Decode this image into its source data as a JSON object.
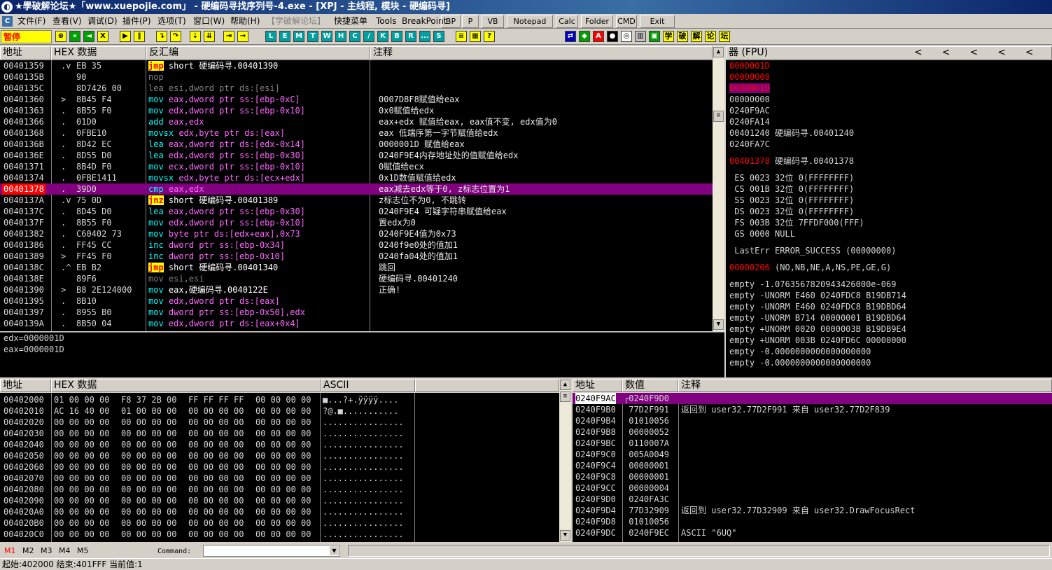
{
  "title": "★學破解论坛★「www.xuepojie.com」 - 硬编码寻找序列号-4.exe - [XPJ - 主线程, 模块 - 硬编码寻]",
  "menu": [
    "文件(F)",
    "查看(V)",
    "调试(D)",
    "插件(P)",
    "选项(T)",
    "窗口(W)",
    "帮助(H)",
    "【学破解论坛】",
    "快捷菜单",
    "Tools",
    "BreakPoint"
  ],
  "quick_buttons": [
    "BP",
    "P",
    "VB",
    "Notepad",
    "Calc",
    "Folder",
    "CMD",
    "Exit"
  ],
  "state": "暂停",
  "toolbar_letters": [
    "L",
    "E",
    "M",
    "T",
    "W",
    "H",
    "C",
    "/",
    "K",
    "B",
    "R",
    "...",
    "S"
  ],
  "toolbar_right": [
    "学",
    "破",
    "解",
    "论",
    "坛"
  ],
  "cpu_headers": {
    "addr": "地址",
    "hex": "HEX 数据",
    "asm": "反汇编",
    "comment": "注释"
  },
  "disasm": [
    {
      "a": "00401359",
      "m": ".v",
      "h": "EB 35",
      "op": "jmp",
      "args": "short 硬编码寻.00401390",
      "c": ""
    },
    {
      "a": "0040135B",
      "m": "",
      "h": "90",
      "op": "nop",
      "args": "",
      "c": ""
    },
    {
      "a": "0040135C",
      "m": "",
      "h": "8D7426 00",
      "op": "lea",
      "args": "esi,dword ptr ds:[esi]",
      "c": ""
    },
    {
      "a": "00401360",
      "m": ">",
      "h": "8B45 F4",
      "op": "mov",
      "args": "eax,dword ptr ss:[ebp-0xC]",
      "c": "0007D8F8赋值给eax"
    },
    {
      "a": "00401363",
      "m": ".",
      "h": "8B55 F0",
      "op": "mov",
      "args": "edx,dword ptr ss:[ebp-0x10]",
      "c": "0x0赋值给edx"
    },
    {
      "a": "00401366",
      "m": ".",
      "h": "01D0",
      "op": "add",
      "args": "eax,edx",
      "c": "eax+edx 赋值给eax, eax值不变, edx值为0"
    },
    {
      "a": "00401368",
      "m": ".",
      "h": "0FBE10",
      "op": "movsx",
      "args": "edx,byte ptr ds:[eax]",
      "c": "eax 低端序第一字节赋值给edx"
    },
    {
      "a": "0040136B",
      "m": ".",
      "h": "8D42 EC",
      "op": "lea",
      "args": "eax,dword ptr ds:[edx-0x14]",
      "c": "0000001D 赋值给eax"
    },
    {
      "a": "0040136E",
      "m": ".",
      "h": "8D55 D0",
      "op": "lea",
      "args": "edx,dword ptr ss:[ebp-0x30]",
      "c": "0240F9E4内存地址处的值赋值给edx"
    },
    {
      "a": "00401371",
      "m": ".",
      "h": "8B4D F0",
      "op": "mov",
      "args": "ecx,dword ptr ss:[ebp-0x10]",
      "c": "0赋值给ecx"
    },
    {
      "a": "00401374",
      "m": ".",
      "h": "0FBE1411",
      "op": "movsx",
      "args": "edx,byte ptr ds:[ecx+edx]",
      "c": "0x1D数值赋值给edx"
    },
    {
      "a": "00401378",
      "m": ".",
      "h": "39D0",
      "op": "cmp",
      "args": "eax,edx",
      "c": "eax减去edx等于0, z标志位置为1"
    },
    {
      "a": "0040137A",
      "m": ".v",
      "h": "75 0D",
      "op": "jnz",
      "args": "short 硬编码寻.00401389",
      "c": "z标志位不为0, 不跳转"
    },
    {
      "a": "0040137C",
      "m": ".",
      "h": "8D45 D0",
      "op": "lea",
      "args": "eax,dword ptr ss:[ebp-0x30]",
      "c": "0240F9E4 可疑字符串赋值给eax"
    },
    {
      "a": "0040137F",
      "m": ".",
      "h": "8B55 F0",
      "op": "mov",
      "args": "edx,dword ptr ss:[ebp-0x10]",
      "c": "置edx为0"
    },
    {
      "a": "00401382",
      "m": ".",
      "h": "C60402 73",
      "op": "mov",
      "args": "byte ptr ds:[edx+eax],0x73",
      "c": "0240F9E4值为0x73"
    },
    {
      "a": "00401386",
      "m": ".",
      "h": "FF45 CC",
      "op": "inc",
      "args": "dword ptr ss:[ebp-0x34]",
      "c": "0240f9e0处的值加1"
    },
    {
      "a": "00401389",
      "m": ">",
      "h": "FF45 F0",
      "op": "inc",
      "args": "dword ptr ss:[ebp-0x10]",
      "c": "0240fa04处的值加1"
    },
    {
      "a": "0040138C",
      "m": ".^",
      "h": "EB B2",
      "op": "jmp",
      "args": "short 硬编码寻.00401340",
      "c": "跳回"
    },
    {
      "a": "0040138E",
      "m": "",
      "h": "89F6",
      "op": "mov",
      "args": "esi,esi",
      "c": "硬编码寻.00401240"
    },
    {
      "a": "00401390",
      "m": ">",
      "h": "B8 2E124000",
      "op": "mov",
      "args": "eax,硬编码寻.0040122E",
      "c": "正确!"
    },
    {
      "a": "00401395",
      "m": ".",
      "h": "8B10",
      "op": "mov",
      "args": "edx,dword ptr ds:[eax]",
      "c": ""
    },
    {
      "a": "00401397",
      "m": ".",
      "h": "8955 B0",
      "op": "mov",
      "args": "dword ptr ss:[ebp-0x50],edx",
      "c": ""
    },
    {
      "a": "0040139A",
      "m": ".",
      "h": "8B50 04",
      "op": "mov",
      "args": "edx,dword ptr ds:[eax+0x4]",
      "c": ""
    }
  ],
  "info_lines": [
    "edx=0000001D",
    "eax=0000001D"
  ],
  "reg_header": "器 (FPU)",
  "regs": [
    {
      "t": "0000001D",
      "cls": "red"
    },
    {
      "t": "00000000",
      "cls": "red"
    },
    {
      "t": "0000001D",
      "cls": "redsel"
    },
    {
      "t": "00000000",
      "cls": ""
    },
    {
      "t": "0240F9AC",
      "cls": ""
    },
    {
      "t": "0240FA14",
      "cls": ""
    },
    {
      "t": "00401240 硬编码寻.00401240",
      "cls": ""
    },
    {
      "t": "0240FA7C",
      "cls": ""
    },
    {
      "t": "",
      "cls": "gap"
    },
    {
      "t": "00401378 硬编码寻.00401378",
      "cls": "redfirst"
    },
    {
      "t": "",
      "cls": "gap"
    },
    {
      "t": " ES 0023 32位 0(FFFFFFFF)",
      "cls": ""
    },
    {
      "t": " CS 001B 32位 0(FFFFFFFF)",
      "cls": ""
    },
    {
      "t": " SS 0023 32位 0(FFFFFFFF)",
      "cls": ""
    },
    {
      "t": " DS 0023 32位 0(FFFFFFFF)",
      "cls": ""
    },
    {
      "t": " FS 003B 32位 7FFDF000(FFF)",
      "cls": ""
    },
    {
      "t": " GS 0000 NULL",
      "cls": ""
    },
    {
      "t": "",
      "cls": "gap"
    },
    {
      "t": " LastErr ERROR_SUCCESS (00000000)",
      "cls": ""
    },
    {
      "t": "",
      "cls": "gap"
    },
    {
      "t": "00000206 (NO,NB,NE,A,NS,PE,GE,G)",
      "cls": "redfirst"
    },
    {
      "t": "",
      "cls": "gap"
    },
    {
      "t": "empty -1.0763567820943426000e-069",
      "cls": ""
    },
    {
      "t": "empty -UNORM E460 0240FDC8 B19DB714",
      "cls": ""
    },
    {
      "t": "empty -UNORM E460 0240FDC8 B19DBD64",
      "cls": ""
    },
    {
      "t": "empty -UNORM B714 00000001 B19DBD64",
      "cls": ""
    },
    {
      "t": "empty +UNORM 0020 0000003B B19DB9E4",
      "cls": ""
    },
    {
      "t": "empty +UNORM 003B 0240FD6C 00000000",
      "cls": ""
    },
    {
      "t": "empty -0.0000000000000000000",
      "cls": ""
    },
    {
      "t": "empty -0.0000000000000000000",
      "cls": ""
    }
  ],
  "dump_headers": {
    "addr": "地址",
    "hex": "HEX 数据",
    "ascii": "ASCII"
  },
  "dump": [
    {
      "a": "00402000",
      "h": "01 00 00 00|F8 37 2B 00|FF FF FF FF|00 00 00 00",
      "s": "■...?+.ÿÿÿÿ...."
    },
    {
      "a": "00402010",
      "h": "AC 16 40 00|01 00 00 00|00 00 00 00|00 00 00 00",
      "s": "?@.■..........."
    },
    {
      "a": "00402020",
      "h": "00 00 00 00|00 00 00 00|00 00 00 00|00 00 00 00",
      "s": "................"
    },
    {
      "a": "00402030",
      "h": "00 00 00 00|00 00 00 00|00 00 00 00|00 00 00 00",
      "s": "................"
    },
    {
      "a": "00402040",
      "h": "00 00 00 00|00 00 00 00|00 00 00 00|00 00 00 00",
      "s": "................"
    },
    {
      "a": "00402050",
      "h": "00 00 00 00|00 00 00 00|00 00 00 00|00 00 00 00",
      "s": "................"
    },
    {
      "a": "00402060",
      "h": "00 00 00 00|00 00 00 00|00 00 00 00|00 00 00 00",
      "s": "................"
    },
    {
      "a": "00402070",
      "h": "00 00 00 00|00 00 00 00|00 00 00 00|00 00 00 00",
      "s": "................"
    },
    {
      "a": "00402080",
      "h": "00 00 00 00|00 00 00 00|00 00 00 00|00 00 00 00",
      "s": "................"
    },
    {
      "a": "00402090",
      "h": "00 00 00 00|00 00 00 00|00 00 00 00|00 00 00 00",
      "s": "................"
    },
    {
      "a": "004020A0",
      "h": "00 00 00 00|00 00 00 00|00 00 00 00|00 00 00 00",
      "s": "................"
    },
    {
      "a": "004020B0",
      "h": "00 00 00 00|00 00 00 00|00 00 00 00|00 00 00 00",
      "s": "................"
    },
    {
      "a": "004020C0",
      "h": "00 00 00 00|00 00 00 00|00 00 00 00|00 00 00 00",
      "s": "................"
    }
  ],
  "stack_headers": {
    "addr": "地址",
    "val": "数值",
    "cmt": "注释"
  },
  "stack": [
    {
      "a": "0240F9AC",
      "v": "0240F9D0",
      "c": ""
    },
    {
      "a": "0240F9B0",
      "v": "77D2F991",
      "c": "返回到 user32.77D2F991 来自 user32.77D2F839"
    },
    {
      "a": "0240F9B4",
      "v": "01010056",
      "c": ""
    },
    {
      "a": "0240F9B8",
      "v": "00000052",
      "c": ""
    },
    {
      "a": "0240F9BC",
      "v": "0110007A",
      "c": ""
    },
    {
      "a": "0240F9C0",
      "v": "005A0049",
      "c": ""
    },
    {
      "a": "0240F9C4",
      "v": "00000001",
      "c": ""
    },
    {
      "a": "0240F9C8",
      "v": "00000001",
      "c": ""
    },
    {
      "a": "0240F9CC",
      "v": "00000004",
      "c": ""
    },
    {
      "a": "0240F9D0",
      "v": "0240FA3C",
      "c": ""
    },
    {
      "a": "0240F9D4",
      "v": "77D32909",
      "c": "返回到 user32.77D32909 来自 user32.DrawFocusRect"
    },
    {
      "a": "0240F9D8",
      "v": "01010056",
      "c": ""
    },
    {
      "a": "0240F9DC",
      "v": "0240F9EC",
      "c": "ASCII \"6UQ\""
    }
  ],
  "mem_tabs": [
    "M1",
    "M2",
    "M3",
    "M4",
    "M5"
  ],
  "command_label": "Command:",
  "status": "起始:402000 结束:401FFF 当前值:1",
  "colors": {
    "selection": "#800080",
    "mnemonic": "#00ffff",
    "jump": "#ffff00",
    "red": "#ff0000"
  }
}
